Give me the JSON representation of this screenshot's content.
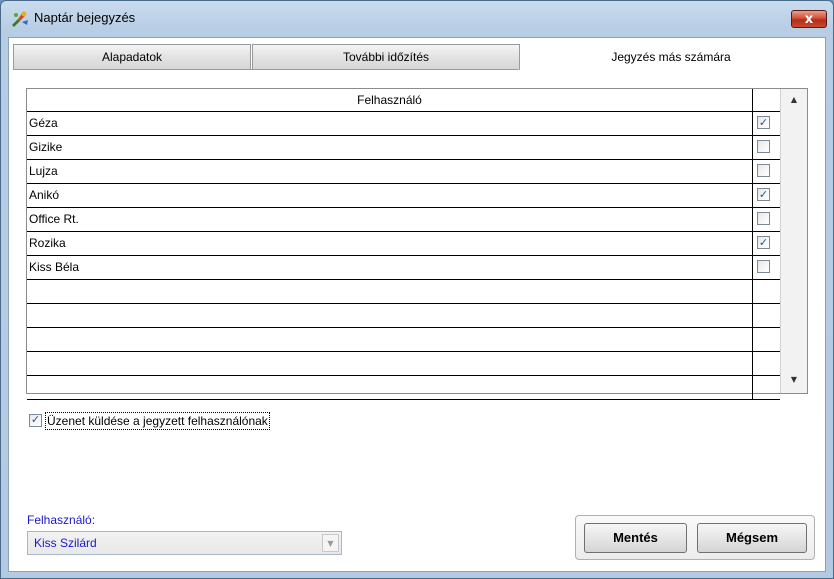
{
  "window": {
    "title": "Naptár bejegyzés",
    "close_label": "x"
  },
  "tabs": [
    {
      "label": "Alapadatok",
      "active": false
    },
    {
      "label": "További időzítés",
      "active": false
    },
    {
      "label": "Jegyzés más számára",
      "active": true
    }
  ],
  "grid": {
    "header": "Felhasználó",
    "rows": [
      {
        "name": "Géza",
        "checked": true
      },
      {
        "name": "Gizike",
        "checked": false
      },
      {
        "name": "Lujza",
        "checked": false
      },
      {
        "name": "Anikó",
        "checked": true
      },
      {
        "name": "Office Rt.",
        "checked": false
      },
      {
        "name": "Rozika",
        "checked": true
      },
      {
        "name": "Kiss Béla",
        "checked": false
      },
      {
        "name": "",
        "checked": null
      },
      {
        "name": "",
        "checked": null
      },
      {
        "name": "",
        "checked": null
      },
      {
        "name": "",
        "checked": null
      },
      {
        "name": "",
        "checked": null
      }
    ]
  },
  "notify": {
    "label": "Üzenet küldése a jegyzett felhasználónak",
    "checked": true
  },
  "user": {
    "label": "Felhasználó:",
    "value": "Kiss Szilárd"
  },
  "buttons": {
    "save": "Mentés",
    "cancel": "Mégsem"
  },
  "icons": {
    "app": "calendar-tool-icon",
    "checkmark": "✓",
    "up": "▲",
    "down": "▼"
  },
  "colors": {
    "link_blue": "#1a1ac8",
    "check_blue": "#2a52b0",
    "close_red": "#c8472e"
  }
}
